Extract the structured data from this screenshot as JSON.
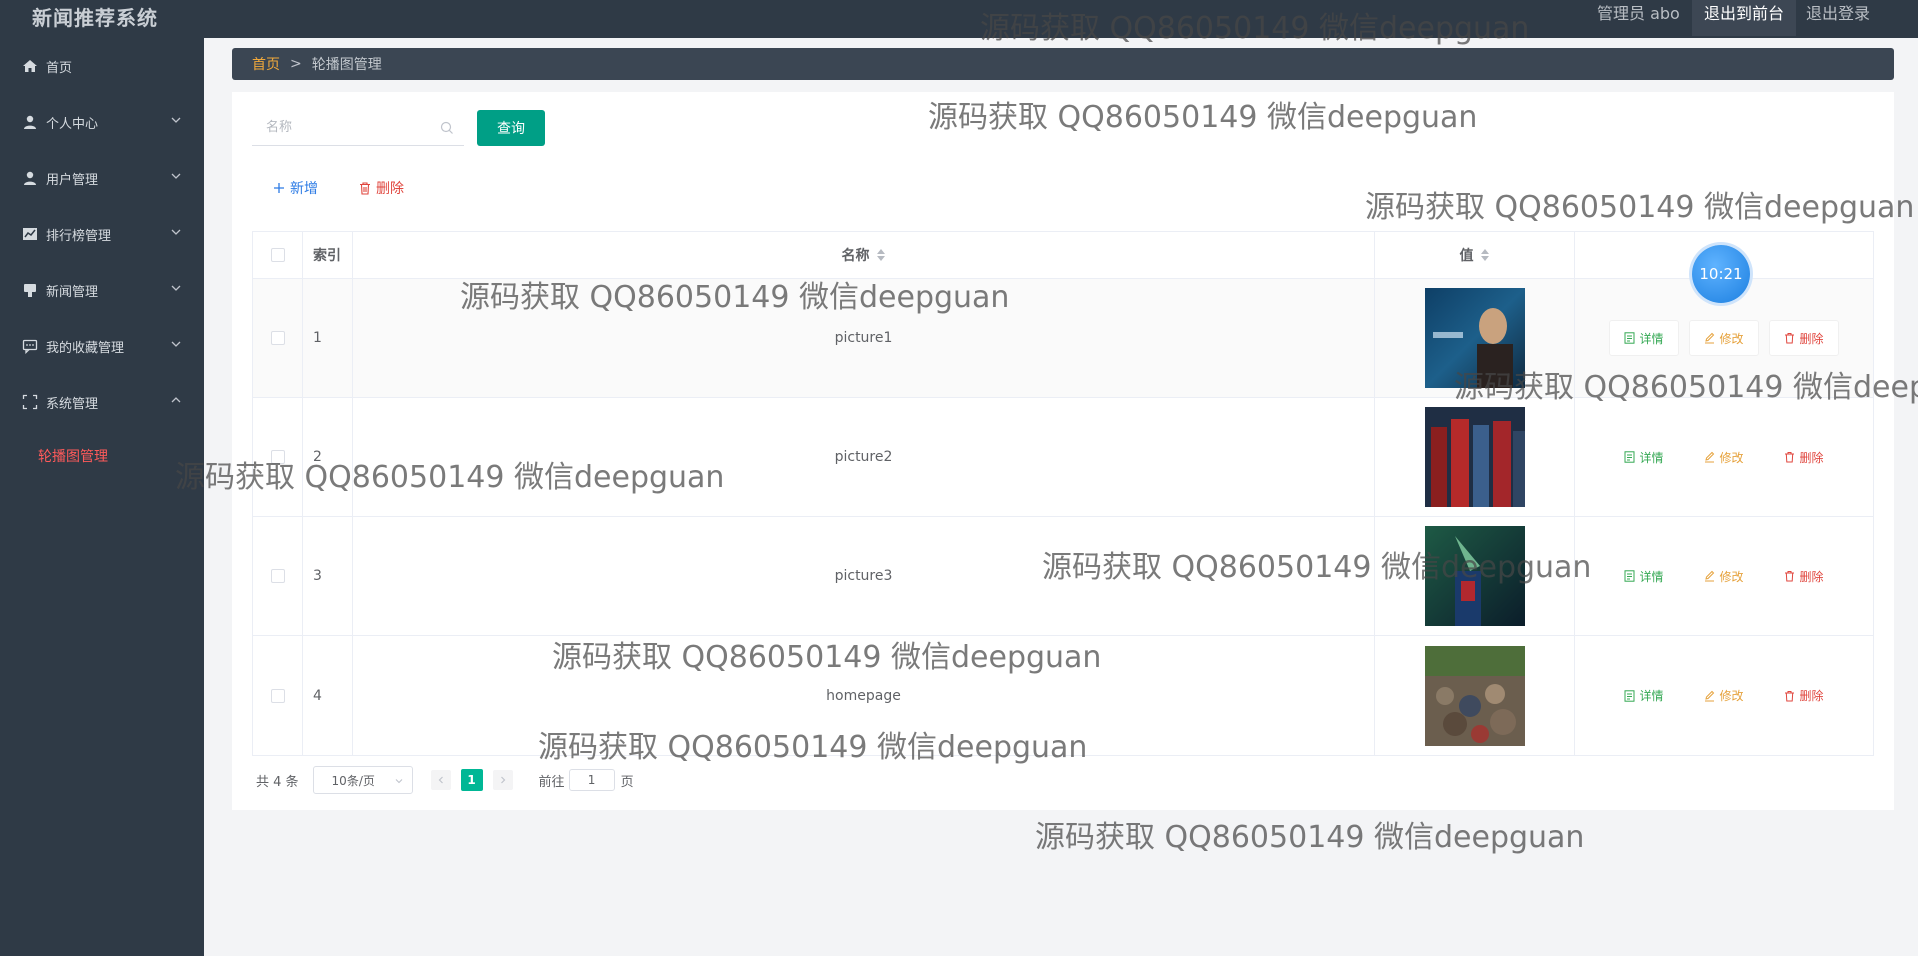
{
  "header": {
    "app_title": "新闻推荐系统",
    "admin_label": "管理员 abo",
    "front_button": "退出到前台",
    "logout_button": "退出登录"
  },
  "sidebar": {
    "items": [
      {
        "label": "首页",
        "icon": "home-icon"
      },
      {
        "label": "个人中心",
        "icon": "user-icon"
      },
      {
        "label": "用户管理",
        "icon": "user-icon"
      },
      {
        "label": "排行榜管理",
        "icon": "chart-icon"
      },
      {
        "label": "新闻管理",
        "icon": "news-icon"
      },
      {
        "label": "我的收藏管理",
        "icon": "chat-icon"
      },
      {
        "label": "系统管理",
        "icon": "fullscreen-icon"
      }
    ],
    "active_sub": "轮播图管理"
  },
  "breadcrumb": {
    "home": "首页",
    "separator": ">",
    "current": "轮播图管理"
  },
  "search": {
    "placeholder": "名称",
    "query_button": "查询"
  },
  "toolbar": {
    "add_label": "新增",
    "delete_label": "删除"
  },
  "table": {
    "headers": {
      "index": "索引",
      "name": "名称",
      "value": "值"
    },
    "rows": [
      {
        "index": "1",
        "name": "picture1"
      },
      {
        "index": "2",
        "name": "picture2"
      },
      {
        "index": "3",
        "name": "picture3"
      },
      {
        "index": "4",
        "name": "homepage"
      }
    ],
    "actions": {
      "detail": "详情",
      "edit": "修改",
      "delete": "删除"
    }
  },
  "pagination": {
    "total": "共 4 条",
    "page_size": "10条/页",
    "current_page": "1",
    "goto_prefix": "前往",
    "goto_value": "1",
    "goto_suffix": "页"
  },
  "clock": "10:21",
  "watermark": "源码获取 QQ86050149 微信deepguan",
  "colors": {
    "accent": "#009f86",
    "danger": "#e0463e",
    "warning": "#e6a23c",
    "success": "#34a853",
    "sidebar": "#2f3a46"
  }
}
